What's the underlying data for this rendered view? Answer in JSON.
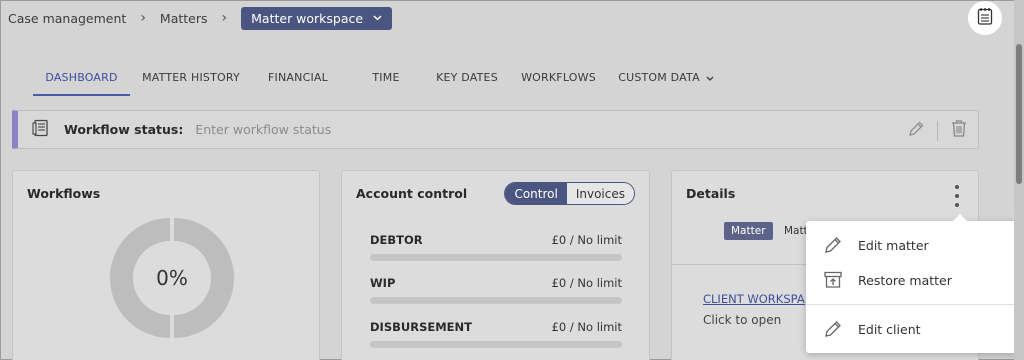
{
  "breadcrumb": {
    "items": [
      "Case management",
      "Matters"
    ],
    "current": "Matter workspace"
  },
  "tabs": [
    {
      "label": "DASHBOARD",
      "active": true
    },
    {
      "label": "MATTER HISTORY"
    },
    {
      "label": "FINANCIAL"
    },
    {
      "label": "TIME"
    },
    {
      "label": "KEY DATES"
    },
    {
      "label": "WORKFLOWS"
    },
    {
      "label": "CUSTOM DATA"
    }
  ],
  "workflow_status": {
    "label": "Workflow status:",
    "placeholder": "Enter workflow status"
  },
  "workflows_card": {
    "title": "Workflows",
    "percent_label": "0%",
    "progress": 0
  },
  "account_card": {
    "title": "Account control",
    "toggle": {
      "control": "Control",
      "invoices": "Invoices"
    },
    "rows": [
      {
        "name": "DEBTOR",
        "value": "£0 / No limit"
      },
      {
        "name": "WIP",
        "value": "£0 / No limit"
      },
      {
        "name": "DISBURSEMENT",
        "value": "£0 / No limit"
      }
    ]
  },
  "details_card": {
    "title": "Details",
    "tab_matter": "Matter",
    "tab_second_partial": "Matt",
    "client_link": "CLIENT WORKSPACE",
    "client_hint": "Click to open"
  },
  "menu": {
    "items": [
      {
        "label": "Edit matter",
        "icon": "pencil-icon"
      },
      {
        "label": "Restore matter",
        "icon": "archive-restore-icon"
      },
      {
        "label": "Edit client",
        "icon": "pencil-icon"
      }
    ]
  },
  "colors": {
    "accent": "#4a5681",
    "tab_active": "#3d4f9c",
    "status_bar": "#8c82c4",
    "background": "#d4d4d4"
  }
}
